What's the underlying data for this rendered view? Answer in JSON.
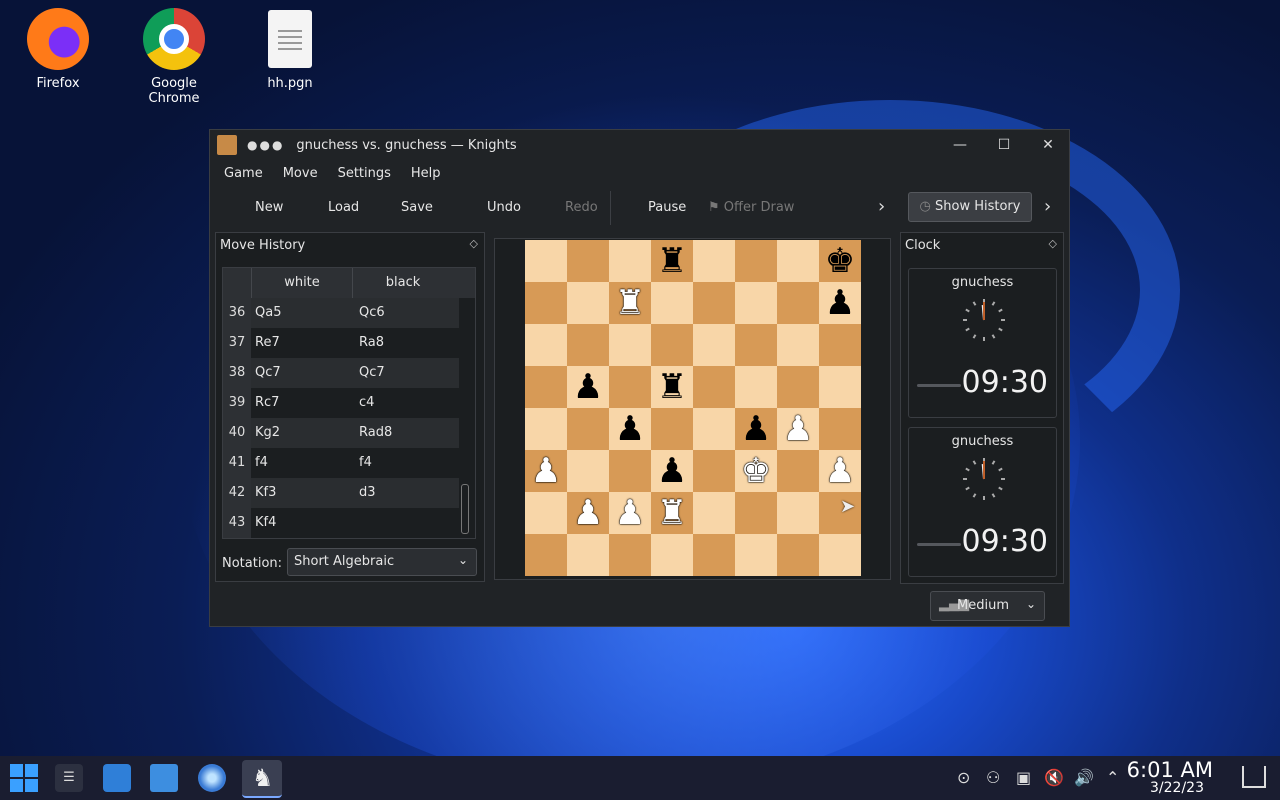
{
  "desktop": {
    "icons": [
      {
        "label": "Firefox"
      },
      {
        "label": "Google Chrome"
      },
      {
        "label": "hh.pgn"
      }
    ]
  },
  "window": {
    "title": "gnuchess vs. gnuchess — Knights",
    "menu": [
      "Game",
      "Move",
      "Settings",
      "Help"
    ],
    "toolbar": {
      "new": "New",
      "load": "Load",
      "save": "Save",
      "undo": "Undo",
      "redo": "Redo",
      "pause": "Pause",
      "offer_draw": "Offer Draw",
      "show_history": "Show History"
    }
  },
  "move_history": {
    "title": "Move History",
    "columns": [
      "white",
      "black"
    ],
    "rows": [
      {
        "n": "36",
        "w": "Qa5",
        "b": "Qc6"
      },
      {
        "n": "37",
        "w": "Re7",
        "b": "Ra8"
      },
      {
        "n": "38",
        "w": "Qc7",
        "b": "Qc7"
      },
      {
        "n": "39",
        "w": "Rc7",
        "b": "c4"
      },
      {
        "n": "40",
        "w": "Kg2",
        "b": "Rad8"
      },
      {
        "n": "41",
        "w": "f4",
        "b": "f4"
      },
      {
        "n": "42",
        "w": "Kf3",
        "b": "d3"
      },
      {
        "n": "43",
        "w": "Kf4",
        "b": ""
      }
    ],
    "notation_label": "Notation:",
    "notation_value": "Short Algebraic"
  },
  "board": {
    "ranks": [
      [
        "",
        "",
        "",
        "bR",
        "",
        "",
        "",
        "bK"
      ],
      [
        "",
        "",
        "wR",
        "",
        "",
        "",
        "",
        "bP"
      ],
      [
        "",
        "",
        "",
        "",
        "",
        "",
        "",
        ""
      ],
      [
        "",
        "bP",
        "",
        "bR",
        "",
        "",
        "",
        ""
      ],
      [
        "",
        "",
        "bP",
        "",
        "",
        "bP",
        "wP",
        ""
      ],
      [
        "wP",
        "",
        "",
        "bP",
        "",
        "wK",
        "",
        "wP"
      ],
      [
        "",
        "wP",
        "wP",
        "wR",
        "",
        "",
        "",
        ""
      ],
      [
        "",
        "",
        "",
        "",
        "",
        "",
        "",
        ""
      ]
    ]
  },
  "clock": {
    "title": "Clock",
    "players": [
      {
        "name": "gnuchess",
        "time": "09:30"
      },
      {
        "name": "gnuchess",
        "time": "09:30"
      }
    ],
    "difficulty": "Medium"
  },
  "taskbar": {
    "time": "6:01 AM",
    "date": "3/22/23"
  }
}
